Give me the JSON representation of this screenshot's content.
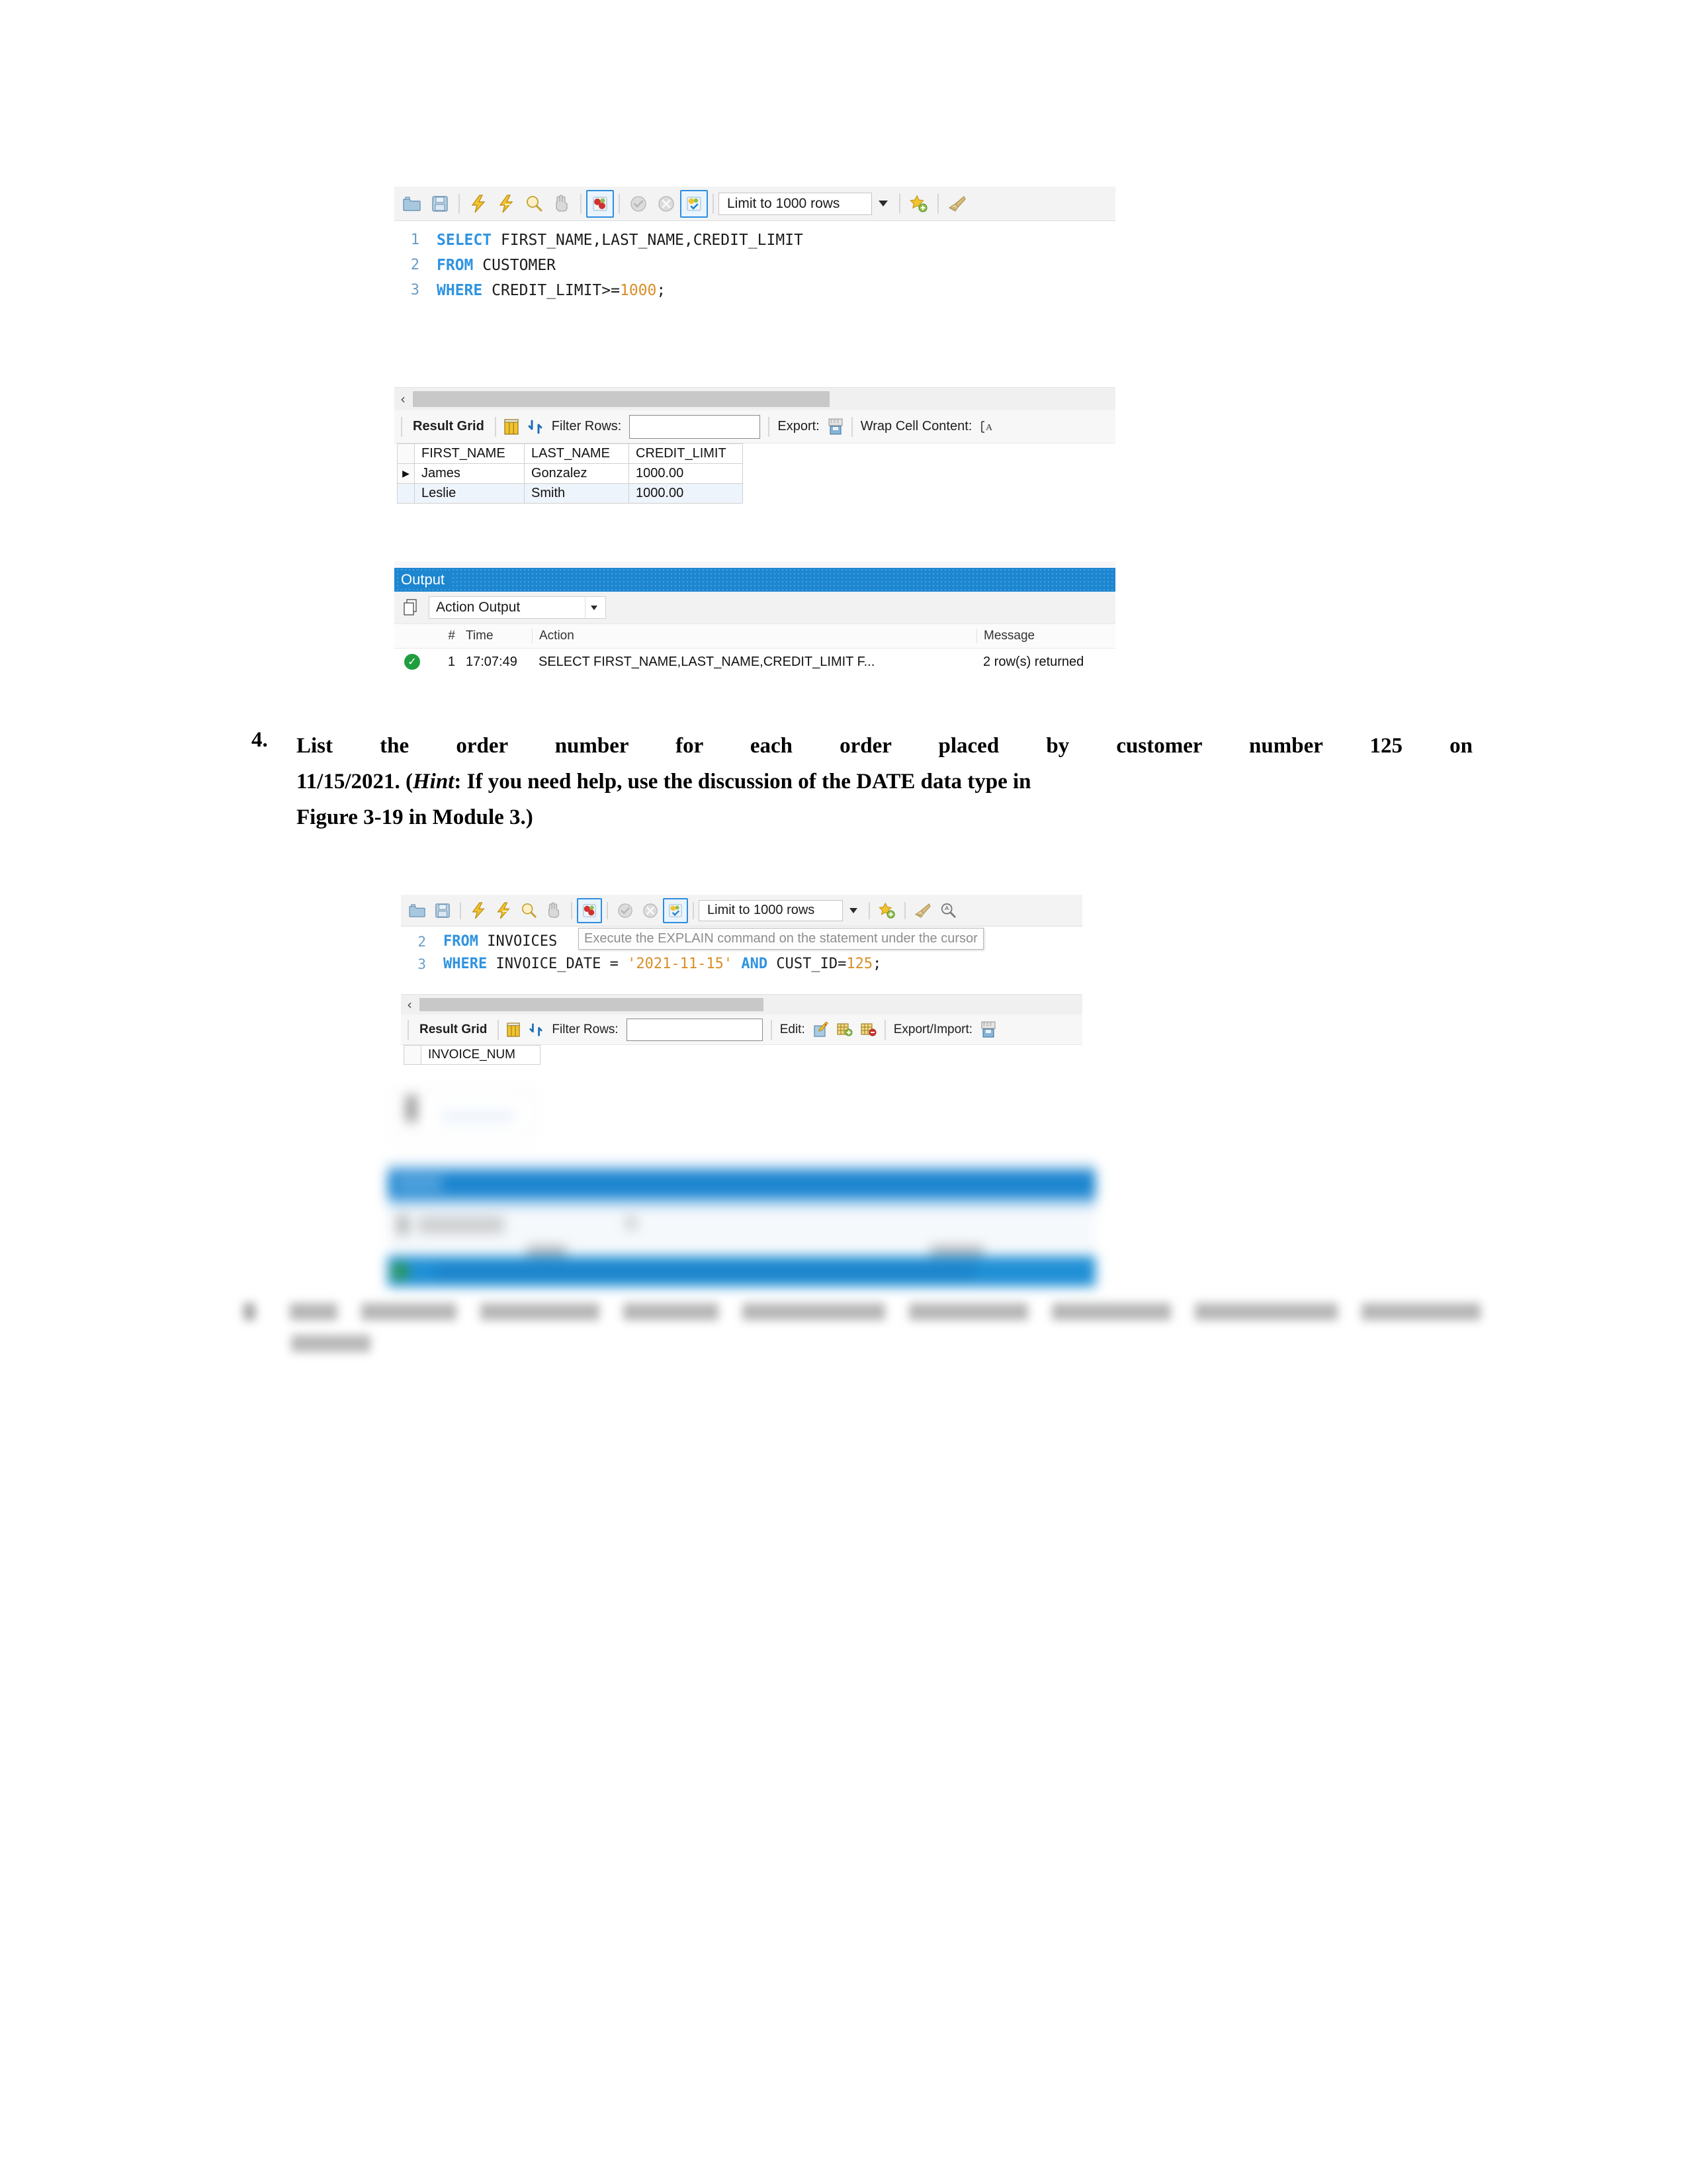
{
  "page": {
    "background": "#ffffff",
    "accent_blue": "#1d86d0",
    "keyword_blue": "#2f93e0",
    "literal_orange": "#d98e28",
    "ok_green": "#1f9d3f"
  },
  "screenshot_one": {
    "toolbar": {
      "icons": [
        "open-folder-icon",
        "save-icon",
        "execute-lightning-icon",
        "execute-current-lightning-icon",
        "explain-magnifier-icon",
        "stop-hand-icon",
        "toggle-stop-on-error-icon",
        "commit-check-icon",
        "rollback-cancel-icon",
        "toggle-autocommit-icon",
        "star-add-icon",
        "beautify-brush-icon"
      ],
      "limit_value": "Limit to 1000 rows",
      "dropdown_icon": "chevron-down-icon"
    },
    "editor": {
      "lines": [
        {
          "no": "1",
          "tokens": [
            {
              "t": "SELECT",
              "k": "kw"
            },
            {
              "t": " FIRST_NAME,LAST_NAME,CREDIT_LIMIT",
              "k": "plain"
            }
          ]
        },
        {
          "no": "2",
          "tokens": [
            {
              "t": "FROM",
              "k": "kw"
            },
            {
              "t": " CUSTOMER",
              "k": "plain"
            }
          ]
        },
        {
          "no": "3",
          "tokens": [
            {
              "t": "WHERE",
              "k": "kw"
            },
            {
              "t": " CREDIT_LIMIT>=",
              "k": "plain"
            },
            {
              "t": "1000",
              "k": "num"
            },
            {
              "t": ";",
              "k": "plain"
            }
          ]
        }
      ]
    },
    "scrollbar": {
      "left_arrow": "‹"
    },
    "result_toolbar": {
      "result_grid_label": "Result Grid",
      "grid_icon": "grid-view-icon",
      "refresh_icon": "refresh-arrows-icon",
      "filter_label": "Filter Rows:",
      "filter_value": "",
      "filter_placeholder": "",
      "export_label": "Export:",
      "export_icon": "export-file-icon",
      "wrap_label": "Wrap Cell Content:",
      "wrap_icon": "wrap-text-icon"
    },
    "result_table": {
      "columns": [
        "FIRST_NAME",
        "LAST_NAME",
        "CREDIT_LIMIT"
      ],
      "rows": [
        {
          "marker": "▶",
          "cells": [
            "James",
            "Gonzalez",
            "1000.00"
          ]
        },
        {
          "marker": "",
          "cells": [
            "Leslie",
            "Smith",
            "1000.00"
          ]
        }
      ]
    },
    "output": {
      "title": "Output",
      "panel_icon": "panels-icon",
      "selector_value": "Action Output",
      "selector_caret": "chevron-down-icon",
      "columns": {
        "status": "",
        "num": "#",
        "time": "Time",
        "action": "Action",
        "message": "Message"
      },
      "rows": [
        {
          "status_icon": "success-check-icon",
          "num": "1",
          "time": "17:07:49",
          "action": "SELECT FIRST_NAME,LAST_NAME,CREDIT_LIMIT F...",
          "message": "2 row(s) returned"
        }
      ]
    }
  },
  "question": {
    "number": "4.",
    "line1": "List the order number for each order placed by customer number 125 on",
    "line2_pre": "11/15/2021. (",
    "line2_hint": "Hint",
    "line2_post": ": If you need help, use the discussion of the DATE data type in",
    "line3": "Figure 3-19 in Module 3.)"
  },
  "screenshot_two": {
    "toolbar": {
      "icons": [
        "open-folder-icon",
        "save-icon",
        "execute-lightning-icon",
        "execute-current-lightning-icon",
        "explain-magnifier-icon",
        "stop-hand-icon",
        "toggle-stop-on-error-icon",
        "commit-check-icon",
        "rollback-cancel-icon",
        "toggle-autocommit-icon",
        "star-add-icon",
        "beautify-brush-icon",
        "search-magnifier-icon"
      ],
      "limit_value": "Limit to 1000 rows",
      "dropdown_icon": "chevron-down-icon"
    },
    "tooltip": "Execute the EXPLAIN command on the statement under the cursor",
    "editor": {
      "lines": [
        {
          "no": "2",
          "tokens": [
            {
              "t": "FROM",
              "k": "kw"
            },
            {
              "t": " INVOICES",
              "k": "plain"
            }
          ]
        },
        {
          "no": "3",
          "tokens": [
            {
              "t": "WHERE",
              "k": "kw"
            },
            {
              "t": " INVOICE_DATE = ",
              "k": "plain"
            },
            {
              "t": "'2021-11-15'",
              "k": "str"
            },
            {
              "t": " ",
              "k": "plain"
            },
            {
              "t": "AND",
              "k": "kw"
            },
            {
              "t": " CUST_ID=",
              "k": "plain"
            },
            {
              "t": "125",
              "k": "num"
            },
            {
              "t": ";",
              "k": "plain"
            }
          ]
        }
      ]
    },
    "scrollbar": {
      "left_arrow": "‹"
    },
    "result_toolbar": {
      "result_grid_label": "Result Grid",
      "grid_icon": "grid-view-icon",
      "refresh_icon": "refresh-arrows-icon",
      "filter_label": "Filter Rows:",
      "filter_value": "",
      "filter_placeholder": "",
      "edit_label": "Edit:",
      "edit_icon": "edit-pencil-icon",
      "insert_row_icon": "insert-row-icon",
      "delete_row_icon": "delete-row-icon",
      "export_import_label": "Export/Import:",
      "export_import_icon": "export-import-icon"
    },
    "result_table": {
      "columns": [
        "INVOICE_NUM"
      ],
      "rows": []
    },
    "blurred_output": {
      "note": "obscured/blurred output panel",
      "title": "",
      "bands": [
        "",
        ""
      ]
    }
  },
  "next_question": {
    "note": "blurred illegible line",
    "text": ""
  }
}
